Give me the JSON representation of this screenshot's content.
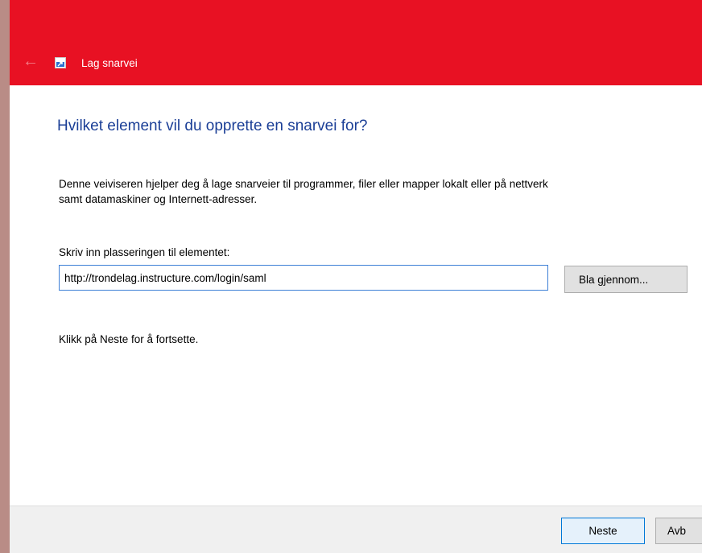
{
  "window": {
    "title": "Lag snarvei",
    "accent_color": "#e81123",
    "back_icon": "back-arrow-icon",
    "app_icon": "shortcut-icon"
  },
  "content": {
    "heading": "Hvilket element vil du opprette en snarvei for?",
    "description_line1": "Denne veiviseren hjelper deg å lage snarveier til programmer, filer eller mapper lokalt eller på nettverk",
    "description_line2": "samt datamaskiner og Internett-adresser.",
    "location_label": "Skriv inn plasseringen til elementet:",
    "location_value": "http://trondelag.instructure.com/login/saml",
    "browse_label": "Bla gjennom...",
    "hint": "Klikk på Neste for å fortsette."
  },
  "footer": {
    "next_label": "Neste",
    "cancel_label": "Avb"
  }
}
